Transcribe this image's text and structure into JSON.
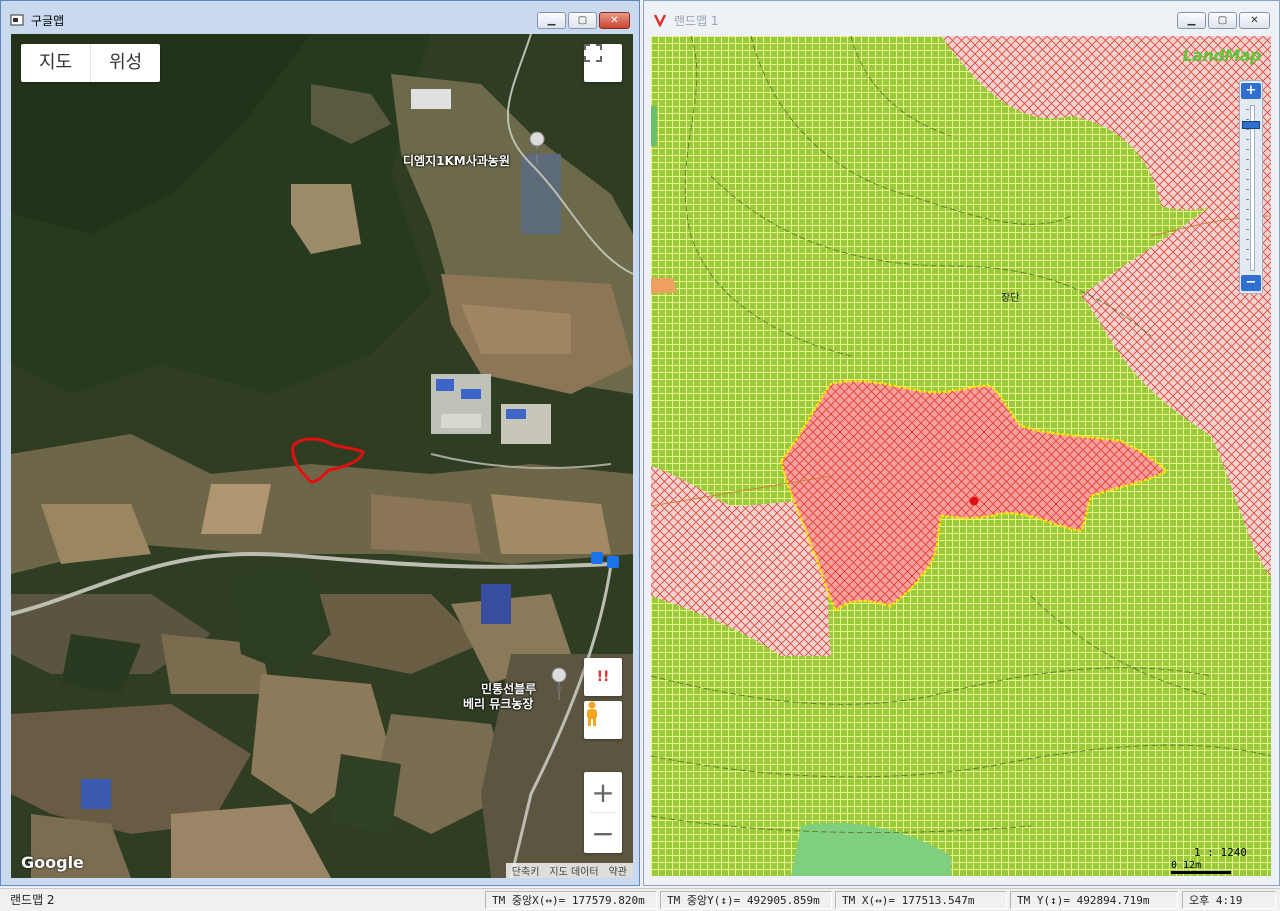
{
  "left_window": {
    "title": "구글맵",
    "map_type_buttons": [
      "지도",
      "위성"
    ],
    "places": [
      {
        "name": "디엠지1KM사과농원"
      },
      {
        "name_line1": "민통선블루",
        "name_line2": "베리 뮤크농장"
      }
    ],
    "google_logo": "Google",
    "attribution": [
      "단축키",
      "지도 데이터",
      "약관"
    ],
    "zoom_in": "+",
    "zoom_out": "−",
    "fullscreen_icon": "fullscreen-icon",
    "pegman_icon": "pegman-icon",
    "alert_label": "!!"
  },
  "right_window": {
    "title": "랜드맵 1",
    "logo": "LandMap",
    "place_label": "장단",
    "scale_ratio": "1 : 1240",
    "scale_bar": "0   12m"
  },
  "status_bar": {
    "title": "랜드맵 2",
    "tm_center_x": "TM 중앙X(↔)= 177579.820m",
    "tm_center_y": "TM 중앙Y(↕)= 492905.859m",
    "tm_x": "TM X(↔)= 177513.547m",
    "tm_y": "TM Y(↕)= 492894.719m",
    "time": "오후 4:19"
  },
  "colors": {
    "parcel_outline": "#e01010",
    "landmap_green": "#9ccc44",
    "landmap_pink": "#f4b9b6",
    "selected_outline": "#ffe600"
  }
}
